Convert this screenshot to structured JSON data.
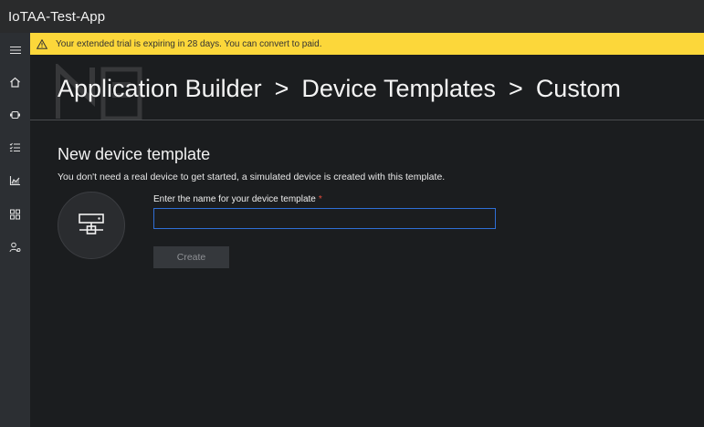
{
  "app": {
    "title": "IoTAA-Test-App"
  },
  "rail": {
    "items": [
      {
        "icon": "hamburger-menu-icon"
      },
      {
        "icon": "home-icon"
      },
      {
        "icon": "device-icon"
      },
      {
        "icon": "rules-list-icon"
      },
      {
        "icon": "analytics-icon"
      },
      {
        "icon": "dashboard-grid-icon"
      },
      {
        "icon": "admin-user-icon"
      }
    ]
  },
  "banner": {
    "icon": "warning-icon",
    "message": "Your extended trial is expiring in 28 days. You can convert to paid.",
    "color": "#fcd73a"
  },
  "breadcrumb": {
    "items": [
      "Application Builder",
      "Device Templates",
      "Custom"
    ],
    "separator": ">"
  },
  "form": {
    "title": "New device template",
    "description": "You don't need a real device to get started, a simulated device is created with this template.",
    "name_label": "Enter the name for your device template",
    "required_marker": "*",
    "name_value": "",
    "create_label": "Create",
    "device_icon": "device-monitor-icon"
  },
  "colors": {
    "accent": "#2f6fd6",
    "required": "#e74c3c"
  }
}
